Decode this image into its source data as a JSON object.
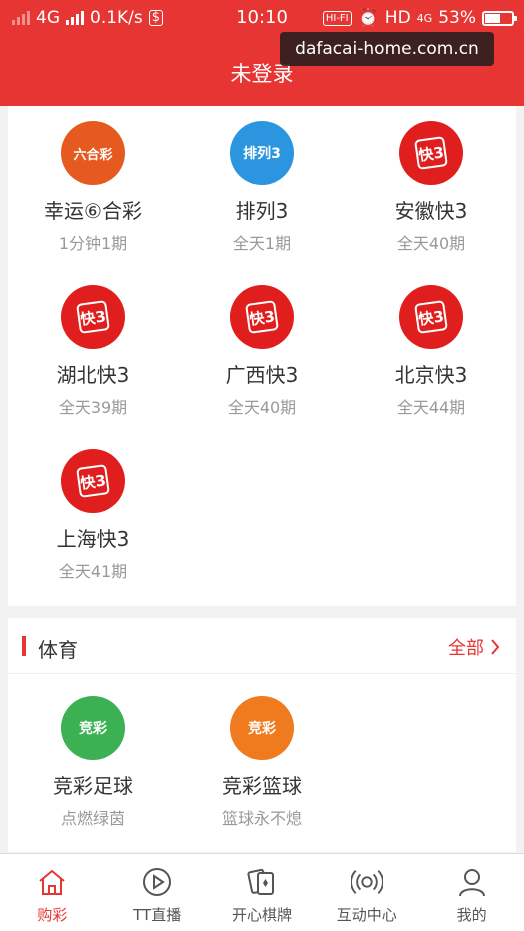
{
  "status_bar": {
    "network": "4G",
    "speed": "0.1K/s",
    "time": "10:10",
    "hifi": "HI-FI",
    "hd": "HD",
    "net2": "4G",
    "battery": "53%"
  },
  "header": {
    "title": "未登录"
  },
  "watermark": "dafacai-home.com.cn",
  "lottery_items": [
    {
      "name": "幸运⑥合彩",
      "sub": "1分钟1期",
      "icon": "liuhecai-logo-icon",
      "logo_text": "六合彩"
    },
    {
      "name": "排列3",
      "sub": "全天1期",
      "icon": "pailie3-logo-icon",
      "logo_text": "排列3"
    },
    {
      "name": "安徽快3",
      "sub": "全天40期",
      "icon": "kuai3-logo-icon",
      "logo_text": "快3"
    },
    {
      "name": "湖北快3",
      "sub": "全天39期",
      "icon": "kuai3-logo-icon",
      "logo_text": "快3"
    },
    {
      "name": "广西快3",
      "sub": "全天40期",
      "icon": "kuai3-logo-icon",
      "logo_text": "快3"
    },
    {
      "name": "北京快3",
      "sub": "全天44期",
      "icon": "kuai3-logo-icon",
      "logo_text": "快3"
    },
    {
      "name": "上海快3",
      "sub": "全天41期",
      "icon": "kuai3-logo-icon",
      "logo_text": "快3"
    }
  ],
  "sports": {
    "title": "体育",
    "more": "全部",
    "items": [
      {
        "name": "竞彩足球",
        "sub": "点燃绿茵",
        "icon": "football-logo-icon",
        "logo_text": "竞彩"
      },
      {
        "name": "竞彩篮球",
        "sub": "篮球永不熄",
        "icon": "basketball-logo-icon",
        "logo_text": "竞彩"
      }
    ]
  },
  "tabs": [
    {
      "label": "购彩",
      "icon": "home-icon",
      "active": true
    },
    {
      "label": "TT直播",
      "icon": "play-icon",
      "active": false
    },
    {
      "label": "开心棋牌",
      "icon": "cards-icon",
      "active": false
    },
    {
      "label": "互动中心",
      "icon": "broadcast-icon",
      "active": false
    },
    {
      "label": "我的",
      "icon": "user-icon",
      "active": false
    }
  ],
  "colors": {
    "brand": "#e73534",
    "k3": "#e01e1e",
    "liuhe": "#e75a1f",
    "pailie": "#2b95df",
    "football": "#3cb154",
    "basketball": "#f07a1e"
  }
}
